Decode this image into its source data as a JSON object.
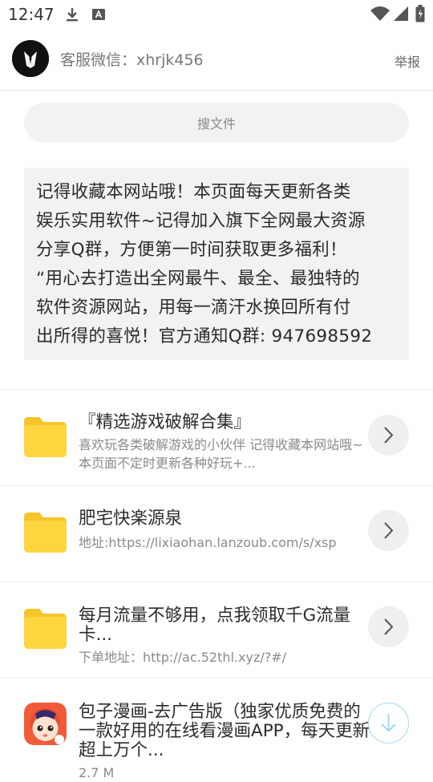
{
  "status_bar": {
    "time": "12:47"
  },
  "header": {
    "title": "客服微信：xhrjk456",
    "report_label": "举报"
  },
  "search": {
    "label": "搜文件"
  },
  "notice": {
    "text": "记得收藏本网站哦！本页面每天更新各类\n娱乐实用软件~记得加入旗下全网最大资源\n分享Q群，方便第一时间获取更多福利！\n“用心去打造出全网最牛、最全、最独特的\n软件资源网站，用每一滴汗水换回所有付\n出所得的喜悦！官方通知Q群: 947698592"
  },
  "items": [
    {
      "title": "『精选游戏破解合集』",
      "subtitle": "喜欢玩各类破解游戏的小伙伴 记得收藏本网站哦~本页面不定时更新各种好玩+..."
    },
    {
      "title": "肥宅快楽源泉",
      "subtitle": "地址:https://lixiaohan.lanzoub.com/s/xsp"
    },
    {
      "title": "每月流量不够用，点我领取千G流量卡...",
      "subtitle": "下单地址：http://ac.52thl.xyz/?#/"
    },
    {
      "title": "包子漫画-去广告版（独家优质免费的一款好用的在线看漫画APP，每天更新超上万个...",
      "subtitle": "2.7 M"
    }
  ],
  "colors": {
    "folder": "#fcd53f",
    "folder_tab": "#f7c42b",
    "download_accent": "#9fd8f2"
  },
  "icons": [
    "download-icon",
    "keyboard-icon",
    "wifi-icon",
    "battery-icon",
    "folder-icon",
    "chevron-right-icon",
    "download-arrow-icon"
  ]
}
